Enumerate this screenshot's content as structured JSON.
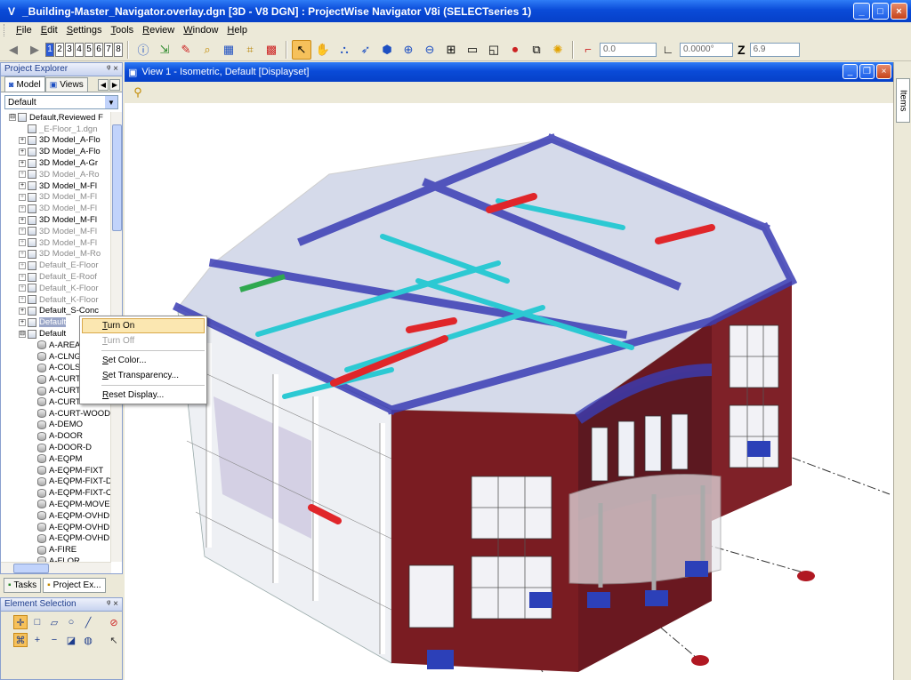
{
  "window": {
    "title": "_Building-Master_Navigator.overlay.dgn [3D - V8 DGN] : ProjectWise Navigator V8i (SELECTseries 1)",
    "app_icon": "V",
    "minimize": "_",
    "maximize": "□",
    "close": "×"
  },
  "menu": [
    "File",
    "Edit",
    "Settings",
    "Tools",
    "Review",
    "Window",
    "Help"
  ],
  "toolbar": {
    "view_numbers": [
      "1",
      "2",
      "3",
      "4",
      "5",
      "6",
      "7",
      "8"
    ],
    "field_x": "0.0",
    "field_angle": "0.0000°",
    "z_label": "Z",
    "field_z": "6.9"
  },
  "project_explorer": {
    "title": "Project Explorer",
    "pins": "ᵠ ×",
    "tabs": [
      "Model",
      "Views"
    ],
    "scroll_left": "◀",
    "scroll_right": "▶",
    "filter_value": "Default",
    "filter_arrow": "▼",
    "tree": [
      {
        "label": "Default,Reviewed F",
        "exp": "⊟",
        "icon": "file",
        "dim": false,
        "indent": 1
      },
      {
        "label": "_E-Floor_1.dgn",
        "exp": "",
        "icon": "file",
        "dim": true,
        "indent": 2
      },
      {
        "label": "3D Model_A-Flo",
        "exp": "+",
        "icon": "file",
        "dim": false,
        "indent": 2
      },
      {
        "label": "3D Model_A-Flo",
        "exp": "+",
        "icon": "file",
        "dim": false,
        "indent": 2
      },
      {
        "label": "3D Model_A-Gr",
        "exp": "+",
        "icon": "file",
        "dim": false,
        "indent": 2
      },
      {
        "label": "3D Model_A-Ro",
        "exp": "+",
        "icon": "file",
        "dim": true,
        "indent": 2
      },
      {
        "label": "3D Model_M-Fl",
        "exp": "+",
        "icon": "file",
        "dim": false,
        "indent": 2
      },
      {
        "label": "3D Model_M-Fl",
        "exp": "+",
        "icon": "file",
        "dim": true,
        "indent": 2
      },
      {
        "label": "3D Model_M-Fl",
        "exp": "+",
        "icon": "file",
        "dim": true,
        "indent": 2
      },
      {
        "label": "3D Model_M-Fl",
        "exp": "+",
        "icon": "file",
        "dim": false,
        "indent": 2
      },
      {
        "label": "3D Model_M-Fl",
        "exp": "+",
        "icon": "file",
        "dim": true,
        "indent": 2
      },
      {
        "label": "3D Model_M-Fl",
        "exp": "+",
        "icon": "file",
        "dim": true,
        "indent": 2
      },
      {
        "label": "3D Model_M-Ro",
        "exp": "+",
        "icon": "file",
        "dim": true,
        "indent": 2
      },
      {
        "label": "Default_E-Floor",
        "exp": "+",
        "icon": "file",
        "dim": true,
        "indent": 2
      },
      {
        "label": "Default_E-Roof",
        "exp": "+",
        "icon": "file",
        "dim": true,
        "indent": 2
      },
      {
        "label": "Default_K-Floor",
        "exp": "+",
        "icon": "file",
        "dim": true,
        "indent": 2
      },
      {
        "label": "Default_K-Floor",
        "exp": "+",
        "icon": "file",
        "dim": true,
        "indent": 2
      },
      {
        "label": "Default_S-Conc",
        "exp": "+",
        "icon": "file",
        "dim": false,
        "indent": 2
      },
      {
        "label": "Default",
        "exp": "+",
        "icon": "file",
        "dim": false,
        "indent": 2,
        "selected": true
      },
      {
        "label": "Default",
        "exp": "⊟",
        "icon": "file",
        "dim": false,
        "indent": 2
      },
      {
        "label": "A-AREA",
        "exp": "",
        "icon": "layer",
        "dim": false,
        "indent": 3
      },
      {
        "label": "A-CLNG",
        "exp": "",
        "icon": "layer",
        "dim": false,
        "indent": 3
      },
      {
        "label": "A-COLS",
        "exp": "",
        "icon": "layer",
        "dim": false,
        "indent": 3
      },
      {
        "label": "A-CURT",
        "exp": "",
        "icon": "layer",
        "dim": false,
        "indent": 3
      },
      {
        "label": "A-CURT",
        "exp": "",
        "icon": "layer",
        "dim": false,
        "indent": 3
      },
      {
        "label": "A-CURT",
        "exp": "",
        "icon": "layer",
        "dim": false,
        "indent": 3
      },
      {
        "label": "A-CURT-WOOD",
        "exp": "",
        "icon": "layer",
        "dim": false,
        "indent": 3
      },
      {
        "label": "A-DEMO",
        "exp": "",
        "icon": "layer",
        "dim": false,
        "indent": 3
      },
      {
        "label": "A-DOOR",
        "exp": "",
        "icon": "layer",
        "dim": false,
        "indent": 3
      },
      {
        "label": "A-DOOR-D",
        "exp": "",
        "icon": "layer",
        "dim": false,
        "indent": 3
      },
      {
        "label": "A-EQPM",
        "exp": "",
        "icon": "layer",
        "dim": false,
        "indent": 3
      },
      {
        "label": "A-EQPM-FIXT",
        "exp": "",
        "icon": "layer",
        "dim": false,
        "indent": 3
      },
      {
        "label": "A-EQPM-FIXT-D",
        "exp": "",
        "icon": "layer",
        "dim": false,
        "indent": 3
      },
      {
        "label": "A-EQPM-FIXT-C",
        "exp": "",
        "icon": "layer",
        "dim": false,
        "indent": 3
      },
      {
        "label": "A-EQPM-MOVE",
        "exp": "",
        "icon": "layer",
        "dim": false,
        "indent": 3
      },
      {
        "label": "A-EQPM-OVHD",
        "exp": "",
        "icon": "layer",
        "dim": false,
        "indent": 3
      },
      {
        "label": "A-EQPM-OVHD",
        "exp": "",
        "icon": "layer",
        "dim": false,
        "indent": 3
      },
      {
        "label": "A-EQPM-OVHD",
        "exp": "",
        "icon": "layer",
        "dim": false,
        "indent": 3
      },
      {
        "label": "A-FIRE",
        "exp": "",
        "icon": "layer",
        "dim": false,
        "indent": 3
      },
      {
        "label": "A-FLOR",
        "exp": "",
        "icon": "layer",
        "dim": false,
        "indent": 3
      }
    ],
    "bottom_tabs": [
      "Tasks",
      "Project Ex..."
    ]
  },
  "element_selection": {
    "title": "Element Selection",
    "pins": "ᵠ ×"
  },
  "context_menu": {
    "items": [
      {
        "label": "Turn On",
        "state": "hover"
      },
      {
        "label": "Turn Off",
        "state": "disabled"
      },
      {
        "label": "Set Color...",
        "state": "normal"
      },
      {
        "label": "Set Transparency...",
        "state": "normal"
      },
      {
        "label": "Reset Display...",
        "state": "normal"
      }
    ]
  },
  "view": {
    "title": "View 1 - Isometric, Default [Displayset]",
    "minimize": "_",
    "restore": "❐",
    "close": "×"
  },
  "items_panel": {
    "tab": "Items"
  },
  "colors": {
    "title_bar": "#0a4bd8",
    "beam_blue": "#3a3db5",
    "brick_red": "#7a1c22",
    "duct_cyan": "#2cc9d3",
    "duct_red": "#e0262a",
    "pipe_green": "#2fa84f"
  }
}
